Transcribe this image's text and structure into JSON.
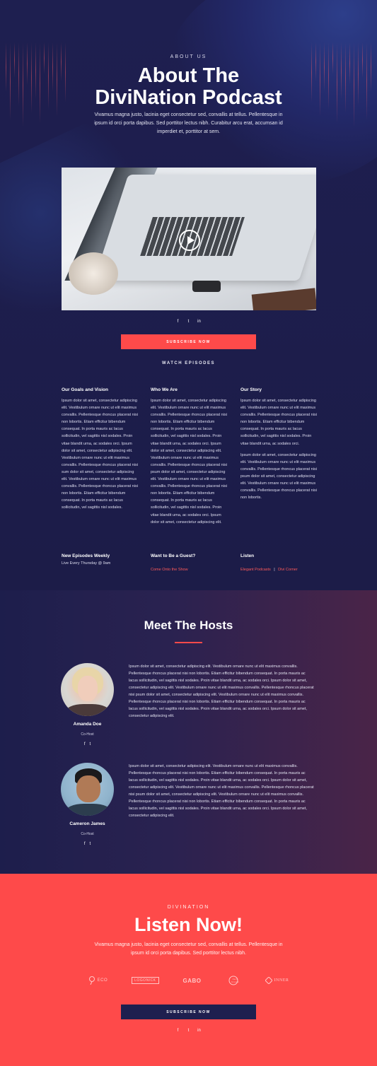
{
  "hero": {
    "eyebrow": "ABOUT US",
    "title_line1": "About The",
    "title_line2": "DiviNation Podcast",
    "description": "Vivamus magna justo, lacinia eget consectetur sed, convallis at tellus. Pellentesque in ipsum id orci porta dapibus. Sed porttitor lectus nibh. Curabitur arcu erat, accumsan id imperdiet et, porttitor at sem.",
    "subscribe_label": "SUBSCRIBE NOW",
    "watch_label": "WATCH EPISODES",
    "social": [
      "f",
      "t",
      "in"
    ]
  },
  "columns": [
    {
      "title": "Our Goals and Vision",
      "paragraphs": [
        "Ipsum dolor sit amet, consectetur adipiscing elit. Vestibulum ornare nunc ut elit maximus convallis. Pellentesque rhoncus placerat nisi non lobortis. Etiam efficitur bibendum consequat. In porta mauris ac lacus sollicitudin, vel sagittis nisl sodales. Proin vitae blandit urna, ac sodales orci. Ipsum dolor sit amet, consectetur adipiscing elit. Vestibulum ornare nunc ut elit maximus convallis. Pellentesque rhoncus placerat nisi sum dolor sit amet, consectetur adipiscing elit. Vestibulum ornare nunc ut elit maximus convallis. Pellentesque rhoncus placerat nisi non lobortis. Etiam efficitur bibendum consequat. In porta mauris ac lacus sollicitudin, vel sagittis nisl sodales."
      ]
    },
    {
      "title": "Who We Are",
      "paragraphs": [
        "Ipsum dolor sit amet, consectetur adipiscing elit. Vestibulum ornare nunc ut elit maximus convallis. Pellentesque rhoncus placerat nisi non lobortis. Etiam efficitur bibendum consequat. In porta mauris ac lacus sollicitudin, vel sagittis nisl sodales. Proin vitae blandit urna, ac sodales orci. Ipsum dolor sit amet, consectetur adipiscing elit. Vestibulum ornare nunc ut elit maximus convallis. Pellentesque rhoncus placerat nisi psum dolor sit amet, consectetur adipiscing elit. Vestibulum ornare nunc ut elit maximus convallis. Pellentesque rhoncus placerat nisi non lobortis. Etiam efficitur bibendum consequat. In porta mauris ac lacus sollicitudin, vel sagittis nisl sodales. Proin vitae blandit urna, ac sodales orci. Ipsum dolor sit amet, consectetur adipiscing elit."
      ]
    },
    {
      "title": "Our Story",
      "paragraphs": [
        "Ipsum dolor sit amet, consectetur adipiscing elit. Vestibulum ornare nunc ut elit maximus convallis. Pellentesque rhoncus placerat nisi non lobortis. Etiam efficitur bibendum consequat. In porta mauris ac lacus sollicitudin, vel sagittis nisl sodales. Proin vitae blandit urna, ac sodales orci.",
        "Ipsum dolor sit amet, consectetur adipiscing elit. Vestibulum ornare nunc ut elit maximus convallis. Pellentesque rhoncus placerat nisi psum dolor sit amet, consectetur adipiscing elit. Vestibulum ornare nunc ut elit maximus convallis. Pellentesque rhoncus placerat nisi non lobortis."
      ]
    }
  ],
  "info": [
    {
      "title": "New Episodes Weekly",
      "text": "Live Every Thursday @ 9am"
    },
    {
      "title": "Want to Be a Guest?",
      "link": "Come Onto the Show"
    },
    {
      "title": "Listen",
      "link1": "Elegant Podcasts",
      "separator": "|",
      "link2": "Divi Corner"
    }
  ],
  "hosts": {
    "title": "Meet The Hosts",
    "people": [
      {
        "name": "Amanda Doe",
        "role": "Co-Host",
        "social": [
          "f",
          "t"
        ],
        "bio": "Ipsum dolor sit amet, consectetur adipiscing elit. Vestibulum ornare nunc ut elit maximus convallis. Pellentesque rhoncus placerat nisi non lobortis. Etiam efficitur bibendum consequat. In porta mauris ac lacus sollicitudin, vel sagittis nisl sodales. Proin vitae blandit urna, ac sodales orci. Ipsum dolor sit amet, consectetur adipiscing elit. Vestibulum ornare nunc ut elit maximus convallis. Pellentesque rhoncus placerat nisi psum dolor sit amet, consectetur adipiscing elit. Vestibulum ornare nunc ut elit maximus convallis. Pellentesque rhoncus placerat nisi non lobortis. Etiam efficitur bibendum consequat. In porta mauris ac lacus sollicitudin, vel sagittis nisl sodales. Proin vitae blandit urna, ac sodales orci. Ipsum dolor sit amet, consectetur adipiscing elit."
      },
      {
        "name": "Cameron James",
        "role": "Co-Host",
        "social": [
          "f",
          "t"
        ],
        "bio": "Ipsum dolor sit amet, consectetur adipiscing elit. Vestibulum ornare nunc ut elit maximus convallis. Pellentesque rhoncus placerat nisi non lobortis. Etiam efficitur bibendum consequat. In porta mauris ac lacus sollicitudin, vel sagittis nisl sodales. Proin vitae blandit urna, ac sodales orci. Ipsum dolor sit amet, consectetur adipiscing elit. Vestibulum ornare nunc ut elit maximus convallis. Pellentesque rhoncus placerat nisi psum dolor sit amet, consectetur adipiscing elit. Vestibulum ornare nunc ut elit maximus convallis. Pellentesque rhoncus placerat nisi non lobortis. Etiam efficitur bibendum consequat. In porta mauris ac lacus sollicitudin, vel sagittis nisl sodales. Proin vitae blandit urna, ac sodales orci. Ipsum dolor sit amet, consectetur adipiscing elit."
      }
    ]
  },
  "listen": {
    "eyebrow": "DIVINATION",
    "title": "Listen Now!",
    "description": "Vivamus magna justo, lacinia eget consectetur sed, convallis at tellus. Pellentesque in ipsum id orci porta dapibus. Sed porttitor lectus nibh.",
    "subscribe_label": "SUBSCRIBE NOW",
    "social": [
      "f",
      "t",
      "in"
    ],
    "logos": [
      "ECO",
      "LOGONICK",
      "GABO",
      "Jack Green",
      "INNER"
    ]
  },
  "colors": {
    "navy": "#1d1d49",
    "accent_red": "#fe4a4a",
    "hosts_gradient_end": "#4a2448"
  }
}
